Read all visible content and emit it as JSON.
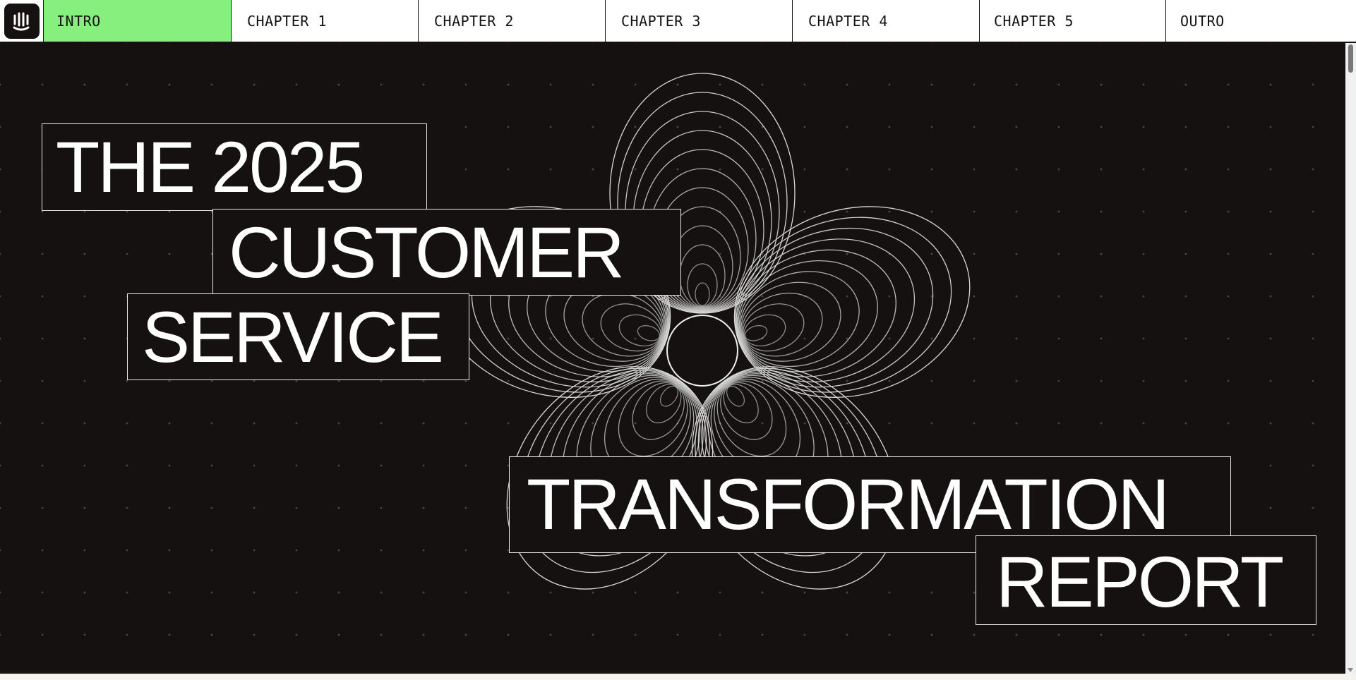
{
  "nav": {
    "logo_icon": "intercom-logo-icon",
    "tabs": [
      {
        "label": "INTRO",
        "active": true
      },
      {
        "label": "CHAPTER 1",
        "active": false
      },
      {
        "label": "CHAPTER 2",
        "active": false
      },
      {
        "label": "CHAPTER 3",
        "active": false
      },
      {
        "label": "CHAPTER 4",
        "active": false
      },
      {
        "label": "CHAPTER 5",
        "active": false
      },
      {
        "label": "OUTRO",
        "active": false
      }
    ],
    "active_color": "#86ef7e"
  },
  "hero": {
    "background_color": "#141110",
    "decoration_icon": "spiral-flower-icon",
    "title_lines": [
      "THE 2025",
      "CUSTOMER",
      "SERVICE",
      "TRANSFORMATION",
      "REPORT"
    ]
  }
}
